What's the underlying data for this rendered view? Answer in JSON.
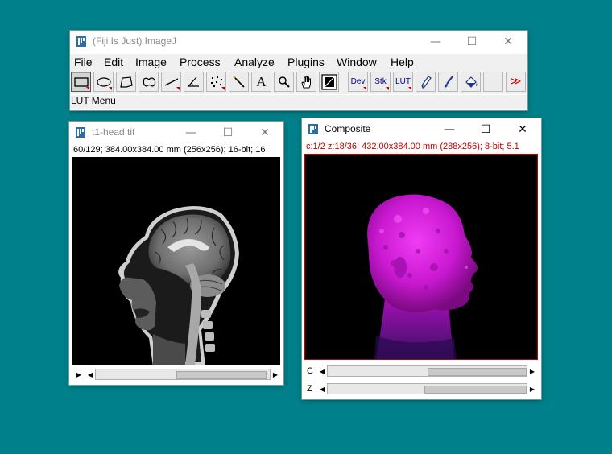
{
  "main_window": {
    "title": "(Fiji Is Just) ImageJ",
    "menu": [
      "File",
      "Edit",
      "Image",
      "Process",
      "Analyze",
      "Plugins",
      "Window",
      "Help"
    ],
    "tools": [
      {
        "name": "rectangle-tool",
        "icon": "rectangle-icon",
        "selected": true,
        "submenu": true
      },
      {
        "name": "oval-tool",
        "icon": "oval-icon",
        "submenu": true
      },
      {
        "name": "polygon-tool",
        "icon": "polygon-icon"
      },
      {
        "name": "freehand-tool",
        "icon": "freehand-icon"
      },
      {
        "name": "line-tool",
        "icon": "line-icon",
        "submenu": true
      },
      {
        "name": "angle-tool",
        "icon": "angle-icon"
      },
      {
        "name": "point-tool",
        "icon": "multipoint-icon",
        "submenu": true
      },
      {
        "name": "wand-tool",
        "icon": "wand-icon"
      },
      {
        "name": "text-tool",
        "icon": "text-icon"
      },
      {
        "name": "magnifier-tool",
        "icon": "magnifier-icon"
      },
      {
        "name": "hand-tool",
        "icon": "hand-icon"
      },
      {
        "name": "color-picker-tool",
        "icon": "color-picker-icon"
      },
      {
        "name": "dev-menu",
        "label": "Dev",
        "submenu": true
      },
      {
        "name": "stk-menu",
        "label": "Stk",
        "submenu": true
      },
      {
        "name": "lut-menu",
        "label": "LUT",
        "submenu": true
      },
      {
        "name": "pencil-tool",
        "icon": "pencil-icon"
      },
      {
        "name": "brush-tool",
        "icon": "brush-icon"
      },
      {
        "name": "flood-fill-tool",
        "icon": "flood-fill-icon"
      },
      {
        "name": "blank-tool",
        "icon": ""
      },
      {
        "name": "more-tools",
        "icon": "more-icon",
        "label": "≫"
      }
    ],
    "status": "LUT Menu"
  },
  "t1_window": {
    "title": "t1-head.tif",
    "info": "60/129; 384.00x384.00 mm (256x256); 16-bit; 16"
  },
  "composite_window": {
    "title": "Composite",
    "info": "c:1/2 z:18/36; 432.00x384.00 mm (288x256); 8-bit; 5.1",
    "slider_c_label": "C",
    "slider_z_label": "Z",
    "c_position": 0.52,
    "z_position": 0.5
  },
  "colors": {
    "desktop": "#00808a",
    "info_red": "#c00000",
    "composite_magenta": "#e020e8"
  }
}
